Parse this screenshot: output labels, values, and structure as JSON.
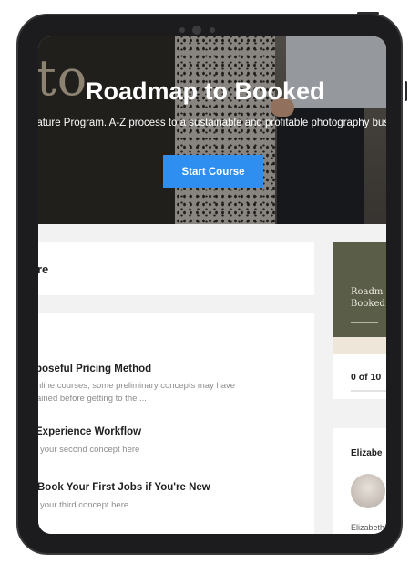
{
  "hero": {
    "script_letters": "to",
    "title": "Roadmap to Booked",
    "subtitle": "nature Program. A-Z process to a sustainable and profitable photography busin",
    "start_label": "Start Course"
  },
  "course_header": {
    "title_fragment": "re"
  },
  "lessons": [
    {
      "title": "poseful Pricing Method",
      "desc": [
        "nline courses, some preliminary concepts may have",
        "ained before getting to the ..."
      ]
    },
    {
      "title": "Experience Workflow",
      "desc": [
        "your second concept here"
      ]
    },
    {
      "title": "Book Your First Jobs if You're New",
      "desc": [
        "your third concept here"
      ]
    }
  ],
  "sidebar": {
    "thumb_lines": [
      "Roadm",
      "Booked"
    ],
    "progress_text": "0 of 10",
    "progress_fraction": 0,
    "author_heading": "Elizabe",
    "author_small": "Elizabeth"
  }
}
